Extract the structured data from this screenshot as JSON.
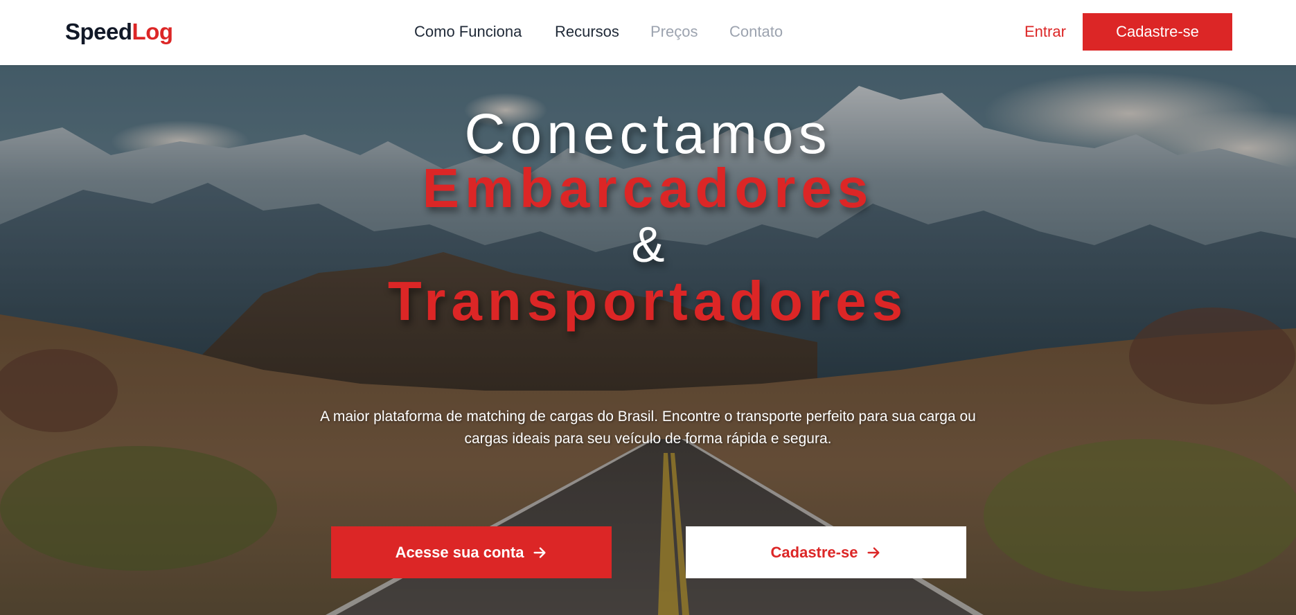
{
  "brand": {
    "part1": "Speed",
    "part2": "Log"
  },
  "nav": {
    "links": [
      "Como Funciona",
      "Recursos",
      "Preços",
      "Contato"
    ],
    "login": "Entrar",
    "signup": "Cadastre-se"
  },
  "hero": {
    "line1": "Conectamos",
    "line2": "Embarcadores",
    "line3": "&",
    "line4": "Transportadores",
    "subtitle": "A maior plataforma de matching de cargas do Brasil. Encontre o transporte perfeito para sua carga ou cargas ideais para seu veículo de forma rápida e segura.",
    "primary_cta": "Acesse sua conta",
    "secondary_cta": "Cadastre-se"
  },
  "colors": {
    "accent": "#dc2626",
    "text_dark": "#1f2937",
    "text_muted": "#9ca3af",
    "white": "#ffffff"
  },
  "icons": {
    "cta_arrow": "arrow-right-icon"
  }
}
